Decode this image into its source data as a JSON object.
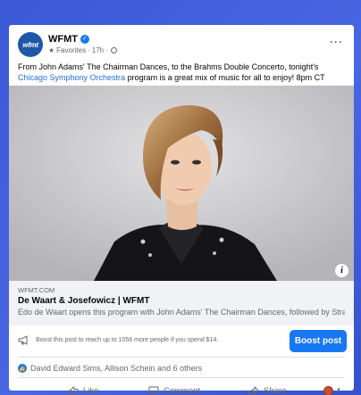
{
  "post": {
    "page_name": "WFMT",
    "avatar_text": "wfmt",
    "meta_favorites": "Favorites",
    "meta_time": "17h",
    "meta_sep": "·",
    "text_before_link": "From John Adams' The Chairman Dances, to the Brahms Double Concerto, tonight's ",
    "text_link": "Chicago Symphony Orchestra",
    "text_after_link": " program is a great mix of music for all to enjoy! 8pm CT"
  },
  "link_preview": {
    "domain": "WFMT.COM",
    "title": "De Waart & Josefowicz | WFMT",
    "description": "Edo de Waart opens this program with John Adams' The Chairman Dances, followed by Stravin..."
  },
  "boost": {
    "text": "Boost this post to reach up to 1056 more people if you spend $14.",
    "button_label": "Boost post"
  },
  "reactions": {
    "summary": "David Edward Sims, Allison Schein and 6 others"
  },
  "actions": {
    "like": "Like",
    "comment": "Comment",
    "share": "Share"
  },
  "icons": {
    "verified": "verified-badge-icon",
    "more": "more-options-icon",
    "info": "info-icon",
    "megaphone": "megaphone-icon",
    "like": "thumbs-up-icon",
    "comment": "comment-bubble-icon",
    "share": "share-arrow-icon"
  },
  "colors": {
    "accent": "#1877f2",
    "link": "#216fdb",
    "background": "#3b59d6"
  }
}
